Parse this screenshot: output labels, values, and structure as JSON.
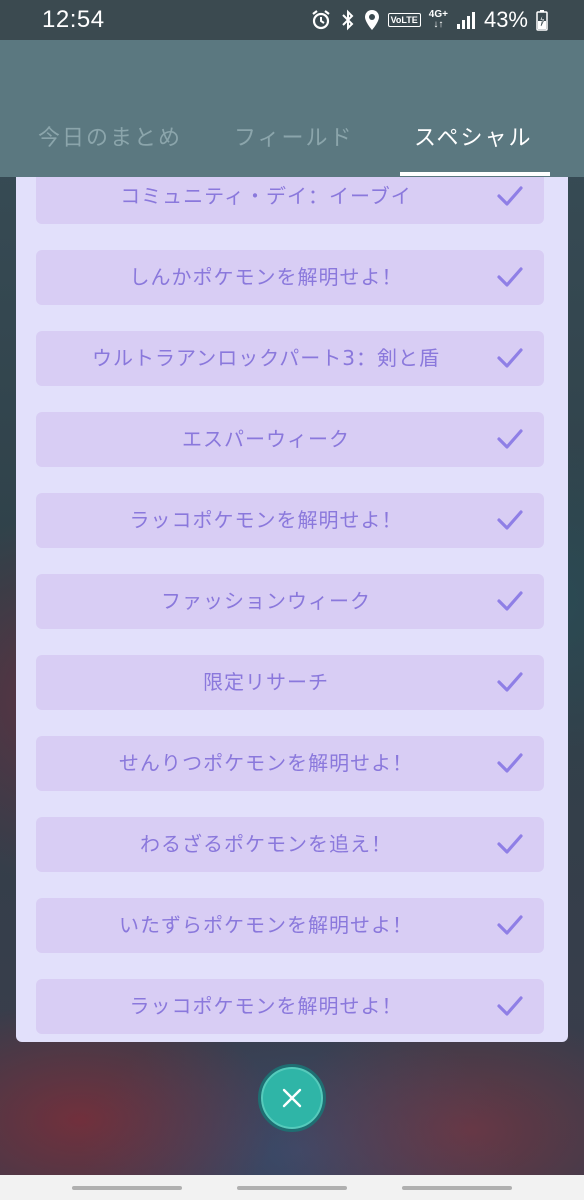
{
  "status_bar": {
    "time": "12:54",
    "volte": "VoLTE",
    "network": "4G+",
    "battery": "43%"
  },
  "tabs": [
    {
      "label": "今日のまとめ",
      "active": false
    },
    {
      "label": "フィールド",
      "active": false
    },
    {
      "label": "スペシャル",
      "active": true
    }
  ],
  "items": [
    {
      "label": "コミュニティ・デイ：イーブイ",
      "completed": true
    },
    {
      "label": "しんかポケモンを解明せよ！",
      "completed": true
    },
    {
      "label": "ウルトラアンロックパート3：剣と盾",
      "completed": true
    },
    {
      "label": "エスパーウィーク",
      "completed": true
    },
    {
      "label": "ラッコポケモンを解明せよ！",
      "completed": true
    },
    {
      "label": "ファッションウィーク",
      "completed": true
    },
    {
      "label": "限定リサーチ",
      "completed": true
    },
    {
      "label": "せんりつポケモンを解明せよ！",
      "completed": true
    },
    {
      "label": "わるざるポケモンを追え！",
      "completed": true
    },
    {
      "label": "いたずらポケモンを解明せよ！",
      "completed": true
    },
    {
      "label": "ラッコポケモンを解明せよ！",
      "completed": true
    }
  ],
  "icons": {
    "check": "check-icon",
    "close": "close-icon"
  },
  "colors": {
    "header": "#5b7880",
    "panel": "#e2e0fb",
    "item": "#d8cdf4",
    "item_text": "#8a78dc",
    "close_button": "#2fb5a7"
  }
}
